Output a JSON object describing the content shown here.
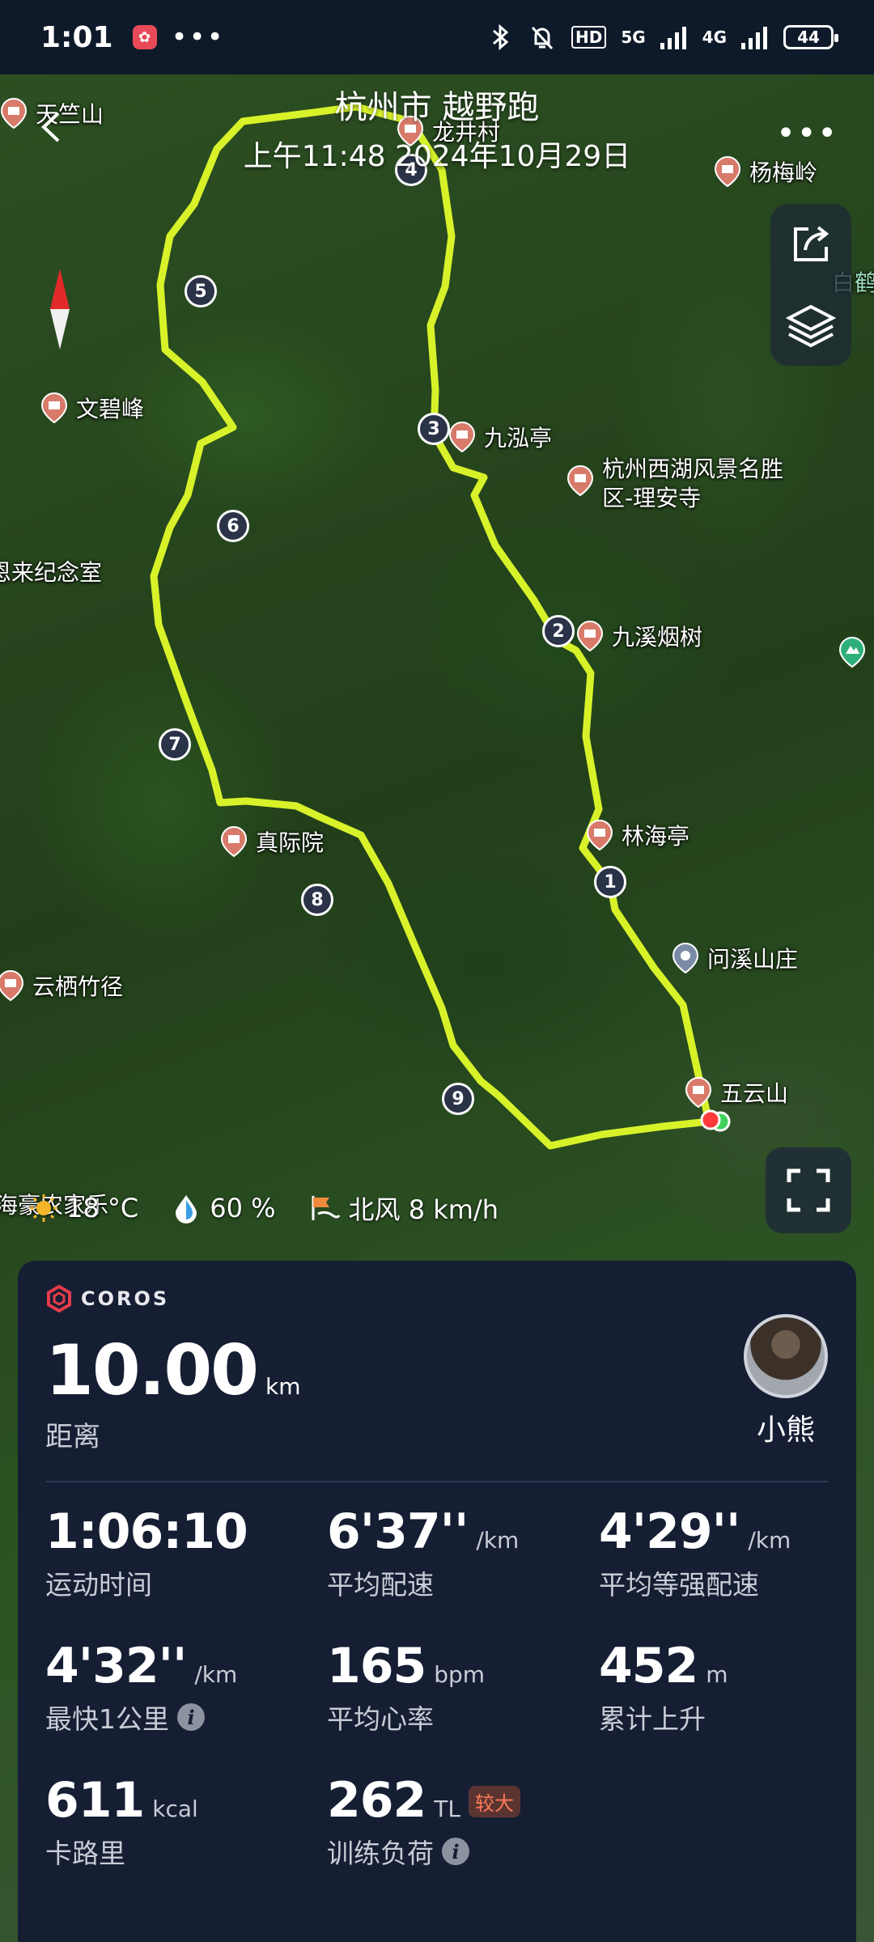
{
  "status_bar": {
    "time": "1:01",
    "dots": "•••",
    "network_label": "HD",
    "signal_5g": "5G",
    "signal_4g": "4G",
    "battery": "44"
  },
  "map": {
    "title": "杭州市 越野跑",
    "datetime": "上午11:48 2024年10月29日",
    "pois": [
      {
        "label": "天竺山"
      },
      {
        "label": "龙井村"
      },
      {
        "label": "杨梅岭"
      },
      {
        "label": "白鹤"
      },
      {
        "label": "文碧峰"
      },
      {
        "label": "九泓亭"
      },
      {
        "label": "杭州西湖风景名胜区-理安寺"
      },
      {
        "label": "恩来纪念室"
      },
      {
        "label": "九溪烟树"
      },
      {
        "label": "林海亭"
      },
      {
        "label": "真际院"
      },
      {
        "label": "问溪山庄"
      },
      {
        "label": "云栖竹径"
      },
      {
        "label": "五云山"
      },
      {
        "label": "海豪农家乐"
      }
    ],
    "km_markers": [
      "1",
      "2",
      "3",
      "4",
      "5",
      "6",
      "7",
      "8",
      "9"
    ],
    "route_color": "#d8f22a",
    "weather": {
      "temp": "18 °C",
      "humidity": "60 %",
      "wind": "北风 8 km/h"
    }
  },
  "card": {
    "brand": "COROS",
    "distance_value": "10.00",
    "distance_unit": "km",
    "distance_label": "距离",
    "user_name": "小熊",
    "stats": [
      {
        "value": "1:06:10",
        "unit": "",
        "label": "运动时间"
      },
      {
        "value": "6'37''",
        "unit": "/km",
        "label": "平均配速"
      },
      {
        "value": "4'29''",
        "unit": "/km",
        "label": "平均等强配速"
      },
      {
        "value": "4'32''",
        "unit": "/km",
        "label": "最快1公里"
      },
      {
        "value": "165",
        "unit": "bpm",
        "label": "平均心率"
      },
      {
        "value": "452",
        "unit": "m",
        "label": "累计上升"
      },
      {
        "value": "611",
        "unit": "kcal",
        "label": "卡路里"
      },
      {
        "value": "262",
        "unit": "TL",
        "label": "训练负荷",
        "badge": "较大"
      }
    ]
  }
}
